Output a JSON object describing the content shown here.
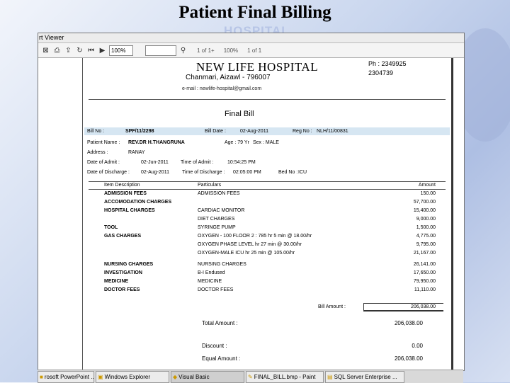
{
  "slide": {
    "title": "Patient Final Billing",
    "bg_logo": "HOSPITAL"
  },
  "window": {
    "title": "rt Viewer",
    "zoom": "100%",
    "toolbar_text": [
      "1  of 1+",
      "100%",
      "1  of 1"
    ]
  },
  "report": {
    "hospital_name": "NEW LIFE HOSPITAL",
    "address": "Chanmari, Aizawl - 796007",
    "email": "e-mail : newlife-hospital@gmail.com",
    "phone1": "Ph : 2349925",
    "phone2": "2304739",
    "bill_title": "Final Bill",
    "bill_no_label": "Bill No :",
    "bill_no": "SPF/11/2298",
    "bill_date_label": "Bill Date :",
    "bill_date": "02-Aug-2011",
    "reg_no_label": "Reg No :",
    "reg_no": "NLH/11/00831",
    "patient_name_label": "Patient Name :",
    "patient_name": "REV.DR H.THANGRUNA",
    "age_label": "Age : 79 Yr",
    "sex_label": "Sex : MALE",
    "address_label": "Address :",
    "patient_address": "RANAY",
    "admit_label": "Date of Admit :",
    "admit_date": "02-Jun-2011",
    "admit_time_label": "Time of Admit :",
    "admit_time": "10:54:25 PM",
    "discharge_label": "Date of Discharge :",
    "discharge_date": "02-Aug-2011",
    "discharge_time_label": "Time of Discharge :",
    "discharge_time": "02:05:00 PM",
    "bed_label": "Bed No :",
    "bed_no": "ICU",
    "col_item": "Item Description",
    "col_particulars": "Particulars",
    "col_amount": "Amount",
    "rows": [
      {
        "item": "ADMISSION FEES",
        "particulars": "ADMISSION FEES",
        "amount": "150.00"
      },
      {
        "item": "ACCOMODATION CHARGES",
        "particulars": "",
        "amount": "57,700.00"
      },
      {
        "item": "HOSPITAL CHARGES",
        "particulars": "CARDIAC MONITOR",
        "amount": "15,400.00"
      },
      {
        "item": "",
        "particulars": "DIET CHARGES",
        "amount": "9,000.00"
      },
      {
        "item": "TOOL",
        "particulars": "SYRINGE PUMP",
        "amount": "1,500.00"
      },
      {
        "item": "GAS CHARGES",
        "particulars": "OXYGEN - 100 FLOOR 2 : 785 hr 5 min @ 18.00/hr",
        "amount": "4,775.00"
      },
      {
        "item": "",
        "particulars": "OXYGEN PHASE LEVEL hr 27 min @ 30.00/hr",
        "amount": "9,795.00"
      },
      {
        "item": "",
        "particulars": "OXYGEN-MALE ICU hr 25 min @ 105.00/hr",
        "amount": "21,167.00"
      },
      {
        "item": "NURSING CHARGES",
        "particulars": "NURSING CHARGES",
        "amount": "26,141.00"
      },
      {
        "item": "INVESTIGATION",
        "particulars": "B-I Endused",
        "amount": "17,650.00"
      },
      {
        "item": "MEDICINE",
        "particulars": "MEDICINE",
        "amount": "79,950.00"
      },
      {
        "item": "DOCTOR FEES",
        "particulars": "DOCTOR FEES",
        "amount": "11,110.00"
      }
    ],
    "bill_amount_label": "Bill Amount :",
    "bill_amount": "206,038.00",
    "total_amount_label": "Total Amount :",
    "total_amount": "206,038.00",
    "discount_label": "Discount :",
    "discount": "0.00",
    "equal_amount_label": "Equal Amount :",
    "equal_amount": "206,038.00"
  },
  "taskbar": [
    {
      "label": "rosoft PowerPoint ...",
      "icon": "powerpoint-icon",
      "active": false
    },
    {
      "label": "Windows Explorer",
      "icon": "folder-icon",
      "active": false
    },
    {
      "label": "Visual Basic",
      "icon": "vb-icon",
      "active": true
    },
    {
      "label": "FINAL_BILL.bmp - Paint",
      "icon": "paint-icon",
      "active": false
    },
    {
      "label": "SQL Server Enterprise ...",
      "icon": "sql-icon",
      "active": false
    }
  ],
  "colors": {
    "info_band": "#d6e6f2",
    "background": "#c9d6ee"
  }
}
